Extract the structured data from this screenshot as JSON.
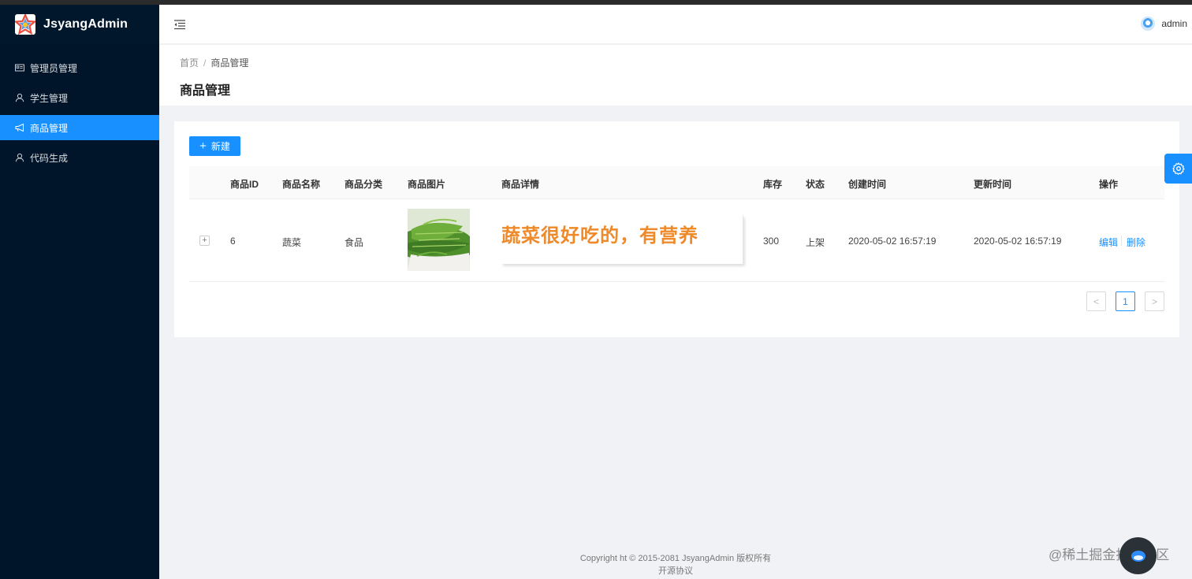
{
  "app": {
    "title": "JsyangAdmin"
  },
  "sidebar": {
    "items": [
      {
        "label": "管理员管理",
        "icon": "id-card-icon",
        "active": false
      },
      {
        "label": "学生管理",
        "icon": "user-icon",
        "active": false
      },
      {
        "label": "商品管理",
        "icon": "megaphone-icon",
        "active": true
      },
      {
        "label": "代码生成",
        "icon": "user-icon",
        "active": false
      }
    ]
  },
  "header": {
    "username": "admin"
  },
  "breadcrumb": {
    "home": "首页",
    "separator": "/",
    "current": "商品管理"
  },
  "page": {
    "title": "商品管理"
  },
  "toolbar": {
    "new_label": "新建"
  },
  "table": {
    "columns": [
      "商品ID",
      "商品名称",
      "商品分类",
      "商品图片",
      "商品详情",
      "库存",
      "状态",
      "创建时间",
      "更新时间",
      "操作"
    ],
    "rows": [
      {
        "id": "6",
        "name": "蔬菜",
        "category": "食品",
        "detail": "蔬菜很好吃的，有营养",
        "stock": "300",
        "status": "上架",
        "created": "2020-05-02 16:57:19",
        "updated": "2020-05-02 16:57:19",
        "edit": "编辑",
        "delete": "删除"
      }
    ]
  },
  "pagination": {
    "prev": "<",
    "current": "1",
    "next": ">"
  },
  "footer": {
    "line1": "Copyright ht © 2015-2081 JsyangAdmin 版权所有",
    "line2": "开源协议"
  },
  "watermark": "@稀土掘金技术社区",
  "colors": {
    "primary": "#1890ff",
    "sidebar_bg": "#001529",
    "detail_text": "#ef8a2b"
  }
}
